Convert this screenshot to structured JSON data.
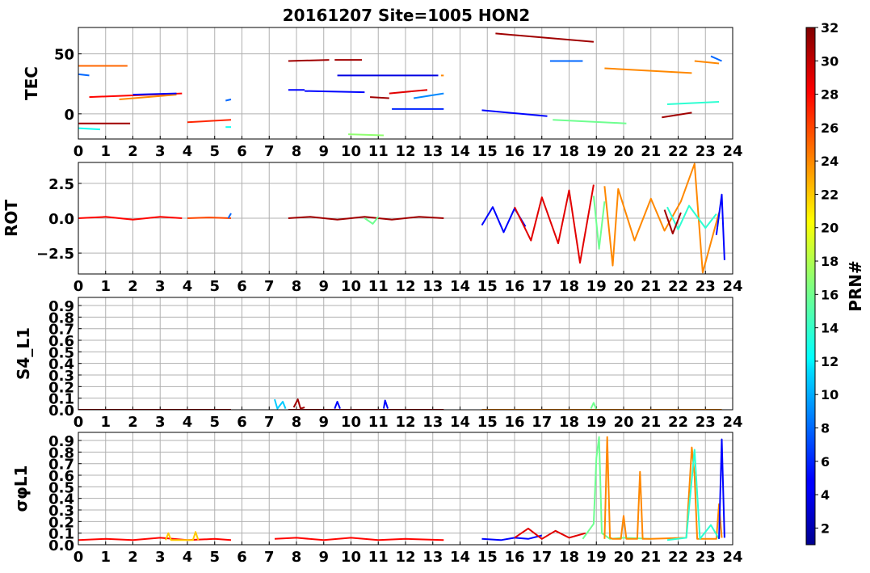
{
  "chart_data": {
    "type": "line",
    "title": "20161207 Site=1005 HON2",
    "x_ticks": [
      "0",
      "1",
      "2",
      "3",
      "4",
      "5",
      "6",
      "7",
      "8",
      "9",
      "10",
      "11",
      "12",
      "13",
      "14",
      "15",
      "16",
      "17",
      "18",
      "19",
      "20",
      "21",
      "22",
      "23",
      "24"
    ],
    "xlim": [
      0,
      24
    ],
    "grid": true,
    "panels": [
      {
        "ylabel": "TEC",
        "ylim": [
          -21,
          72
        ],
        "y_ticks": [
          {
            "v": 50,
            "label": "50"
          },
          {
            "v": 0,
            "label": "0"
          }
        ],
        "series": [
          {
            "prn": 25,
            "x": [
              0.0,
              1.8
            ],
            "y": [
              40,
              40
            ]
          },
          {
            "prn": 8,
            "x": [
              0.0,
              0.4
            ],
            "y": [
              33,
              32
            ]
          },
          {
            "prn": 28,
            "x": [
              0.4,
              3.8
            ],
            "y": [
              14,
              17
            ]
          },
          {
            "prn": 24,
            "x": [
              1.5,
              3.6
            ],
            "y": [
              12,
              16
            ]
          },
          {
            "prn": 5,
            "x": [
              2.0,
              3.6
            ],
            "y": [
              16,
              17
            ]
          },
          {
            "prn": 31,
            "x": [
              0.0,
              1.9
            ],
            "y": [
              -8,
              -8
            ]
          },
          {
            "prn": 13,
            "x": [
              0.0,
              0.8
            ],
            "y": [
              -12,
              -13
            ]
          },
          {
            "prn": 27,
            "x": [
              4.0,
              5.6
            ],
            "y": [
              -7,
              -5
            ]
          },
          {
            "prn": 8,
            "x": [
              5.4,
              5.6
            ],
            "y": [
              11,
              12
            ]
          },
          {
            "prn": 13,
            "x": [
              5.4,
              5.6
            ],
            "y": [
              -11,
              -11
            ]
          },
          {
            "prn": 31,
            "x": [
              7.7,
              9.2
            ],
            "y": [
              44,
              45
            ]
          },
          {
            "prn": 31,
            "x": [
              9.4,
              10.4
            ],
            "y": [
              45,
              45
            ]
          },
          {
            "prn": 5,
            "x": [
              7.7,
              8.3
            ],
            "y": [
              20,
              20
            ]
          },
          {
            "prn": 5,
            "x": [
              8.3,
              10.5
            ],
            "y": [
              19,
              18
            ]
          },
          {
            "prn": 4,
            "x": [
              9.5,
              13.2
            ],
            "y": [
              32,
              32
            ]
          },
          {
            "prn": 31,
            "x": [
              10.7,
              11.4
            ],
            "y": [
              14,
              13
            ]
          },
          {
            "prn": 29,
            "x": [
              11.4,
              12.8
            ],
            "y": [
              17,
              20
            ]
          },
          {
            "prn": 9,
            "x": [
              12.3,
              13.4
            ],
            "y": [
              13,
              17
            ]
          },
          {
            "prn": 6,
            "x": [
              11.5,
              13.4
            ],
            "y": [
              4,
              4
            ]
          },
          {
            "prn": 17,
            "x": [
              9.9,
              11.2
            ],
            "y": [
              -17,
              -18
            ]
          },
          {
            "prn": 24,
            "x": [
              13.3,
              13.4
            ],
            "y": [
              32,
              32
            ]
          },
          {
            "prn": 31,
            "x": [
              15.3,
              18.9
            ],
            "y": [
              67,
              60
            ]
          },
          {
            "prn": 8,
            "x": [
              17.3,
              18.5
            ],
            "y": [
              44,
              44
            ]
          },
          {
            "prn": 5,
            "x": [
              14.8,
              17.2
            ],
            "y": [
              3,
              -2
            ]
          },
          {
            "prn": 16,
            "x": [
              17.4,
              20.1
            ],
            "y": [
              -5,
              -8
            ]
          },
          {
            "prn": 24,
            "x": [
              19.3,
              22.5
            ],
            "y": [
              38,
              34
            ]
          },
          {
            "prn": 24,
            "x": [
              22.6,
              23.5
            ],
            "y": [
              44,
              42
            ]
          },
          {
            "prn": 8,
            "x": [
              23.2,
              23.6
            ],
            "y": [
              48,
              44
            ]
          },
          {
            "prn": 14,
            "x": [
              21.6,
              23.5
            ],
            "y": [
              8,
              10
            ]
          },
          {
            "prn": 31,
            "x": [
              21.4,
              22.5
            ],
            "y": [
              -3,
              1
            ]
          }
        ]
      },
      {
        "ylabel": "ROT",
        "ylim": [
          -4.0,
          4.0
        ],
        "y_ticks": [
          {
            "v": 2.5,
            "label": "2.5"
          },
          {
            "v": 0,
            "label": "0.0"
          },
          {
            "v": -2.5,
            "label": "−2.5"
          }
        ],
        "series": [
          {
            "prn": 28,
            "x": [
              0.0,
              1.0,
              2.0,
              3.0,
              3.8
            ],
            "y": [
              0.0,
              0.1,
              -0.1,
              0.1,
              0.0
            ]
          },
          {
            "prn": 26,
            "x": [
              4.0,
              4.8,
              5.6
            ],
            "y": [
              0.0,
              0.05,
              0.0
            ]
          },
          {
            "prn": 8,
            "x": [
              5.5,
              5.6
            ],
            "y": [
              0.0,
              0.35
            ]
          },
          {
            "prn": 31,
            "x": [
              7.7,
              8.5,
              9.5,
              10.5,
              11.5,
              12.5,
              13.4
            ],
            "y": [
              0.0,
              0.1,
              -0.1,
              0.1,
              -0.1,
              0.1,
              0.0
            ]
          },
          {
            "prn": 16,
            "x": [
              10.5,
              10.8,
              11.0
            ],
            "y": [
              0.0,
              -0.4,
              0.1
            ]
          },
          {
            "prn": 5,
            "x": [
              14.8,
              15.2,
              15.6,
              16.0,
              16.4
            ],
            "y": [
              -0.5,
              0.8,
              -1.0,
              0.7,
              -0.6
            ]
          },
          {
            "prn": 29,
            "x": [
              16.0,
              16.6,
              17.0,
              17.6,
              18.0,
              18.4,
              18.9
            ],
            "y": [
              0.8,
              -1.6,
              1.5,
              -1.8,
              2.0,
              -3.2,
              2.4
            ]
          },
          {
            "prn": 16,
            "x": [
              18.9,
              19.1,
              19.3
            ],
            "y": [
              1.6,
              -2.2,
              1.2
            ]
          },
          {
            "prn": 24,
            "x": [
              19.3,
              19.6,
              19.8,
              20.4,
              21.0,
              21.5,
              22.1,
              22.6,
              22.9,
              23.5
            ],
            "y": [
              2.3,
              -3.4,
              2.1,
              -1.6,
              1.4,
              -0.9,
              1.2,
              3.9,
              -3.9,
              0.4
            ]
          },
          {
            "prn": 14,
            "x": [
              21.6,
              22.0,
              22.4,
              23.0,
              23.4
            ],
            "y": [
              0.8,
              -0.8,
              0.9,
              -0.7,
              0.3
            ]
          },
          {
            "prn": 31,
            "x": [
              21.5,
              21.8,
              22.1
            ],
            "y": [
              0.6,
              -1.1,
              0.4
            ]
          },
          {
            "prn": 5,
            "x": [
              23.4,
              23.6,
              23.7
            ],
            "y": [
              -1.2,
              1.7,
              -3.0
            ]
          }
        ]
      },
      {
        "ylabel": "S4_L1",
        "ylim": [
          0.0,
          0.97
        ],
        "y_ticks": [
          {
            "v": 0.0,
            "label": "0.0"
          },
          {
            "v": 0.1,
            "label": "0.1"
          },
          {
            "v": 0.2,
            "label": "0.2"
          },
          {
            "v": 0.3,
            "label": "0.3"
          },
          {
            "v": 0.4,
            "label": "0.4"
          },
          {
            "v": 0.5,
            "label": "0.5"
          },
          {
            "v": 0.6,
            "label": "0.6"
          },
          {
            "v": 0.7,
            "label": "0.7"
          },
          {
            "v": 0.8,
            "label": "0.8"
          },
          {
            "v": 0.9,
            "label": "0.9"
          }
        ],
        "series": [
          {
            "prn": 31,
            "x": [
              0.0,
              5.6
            ],
            "y": [
              0.0,
              0.0
            ]
          },
          {
            "prn": 11,
            "x": [
              7.2,
              7.3,
              7.5,
              7.6
            ],
            "y": [
              0.09,
              0.01,
              0.07,
              0.01
            ]
          },
          {
            "prn": 31,
            "x": [
              7.9,
              8.05,
              8.15,
              8.3
            ],
            "y": [
              0.02,
              0.09,
              0.01,
              0.02
            ]
          },
          {
            "prn": 5,
            "x": [
              9.4,
              9.5,
              9.6
            ],
            "y": [
              0.01,
              0.07,
              0.01
            ]
          },
          {
            "prn": 5,
            "x": [
              11.2,
              11.25,
              11.35
            ],
            "y": [
              0.01,
              0.08,
              0.01
            ]
          },
          {
            "prn": 31,
            "x": [
              7.7,
              13.4
            ],
            "y": [
              0.0,
              0.0
            ]
          },
          {
            "prn": 16,
            "x": [
              18.8,
              18.9,
              19.0
            ],
            "y": [
              0.01,
              0.06,
              0.0
            ]
          },
          {
            "prn": 24,
            "x": [
              14.8,
              23.6
            ],
            "y": [
              0.0,
              0.0
            ]
          }
        ]
      },
      {
        "ylabel": "σφL1",
        "ylim": [
          0.0,
          0.97
        ],
        "y_ticks": [
          {
            "v": 0.0,
            "label": "0.0"
          },
          {
            "v": 0.1,
            "label": "0.1"
          },
          {
            "v": 0.2,
            "label": "0.2"
          },
          {
            "v": 0.3,
            "label": "0.3"
          },
          {
            "v": 0.4,
            "label": "0.4"
          },
          {
            "v": 0.5,
            "label": "0.5"
          },
          {
            "v": 0.6,
            "label": "0.6"
          },
          {
            "v": 0.7,
            "label": "0.7"
          },
          {
            "v": 0.8,
            "label": "0.8"
          },
          {
            "v": 0.9,
            "label": "0.9"
          }
        ],
        "series": [
          {
            "prn": 28,
            "x": [
              0.0,
              1.0,
              2.0,
              3.0,
              4.0,
              5.0,
              5.6
            ],
            "y": [
              0.04,
              0.05,
              0.04,
              0.06,
              0.04,
              0.05,
              0.04
            ]
          },
          {
            "prn": 22,
            "x": [
              3.2,
              3.3,
              3.4,
              4.2,
              4.3,
              4.4
            ],
            "y": [
              0.04,
              0.1,
              0.04,
              0.04,
              0.11,
              0.04
            ]
          },
          {
            "prn": 28,
            "x": [
              7.2,
              8.0,
              9.0,
              10.0,
              11.0,
              12.0,
              13.4
            ],
            "y": [
              0.05,
              0.06,
              0.04,
              0.06,
              0.04,
              0.05,
              0.04
            ]
          },
          {
            "prn": 5,
            "x": [
              14.8,
              15.5,
              16.0,
              16.5,
              17.0
            ],
            "y": [
              0.05,
              0.04,
              0.06,
              0.05,
              0.08
            ]
          },
          {
            "prn": 29,
            "x": [
              16.0,
              16.5,
              17.0,
              17.5,
              18.0,
              18.6
            ],
            "y": [
              0.06,
              0.14,
              0.05,
              0.12,
              0.06,
              0.1
            ]
          },
          {
            "prn": 16,
            "x": [
              18.5,
              18.9,
              19.0,
              19.1,
              19.2,
              19.5,
              20.0,
              21.0
            ],
            "y": [
              0.05,
              0.18,
              0.75,
              0.93,
              0.1,
              0.05,
              0.06,
              0.05
            ]
          },
          {
            "prn": 24,
            "x": [
              19.3,
              19.4,
              19.5,
              19.6,
              19.9,
              20.0,
              20.1,
              20.5,
              20.6,
              20.7,
              21.0,
              22.3,
              22.5,
              22.6,
              22.7,
              22.9,
              23.4,
              23.5,
              23.6
            ],
            "y": [
              0.05,
              0.93,
              0.06,
              0.05,
              0.05,
              0.25,
              0.05,
              0.05,
              0.63,
              0.05,
              0.05,
              0.06,
              0.84,
              0.6,
              0.05,
              0.05,
              0.05,
              0.35,
              0.06
            ]
          },
          {
            "prn": 14,
            "x": [
              21.6,
              22.3,
              22.6,
              22.8,
              23.2,
              23.5
            ],
            "y": [
              0.04,
              0.06,
              0.82,
              0.05,
              0.17,
              0.05
            ]
          },
          {
            "prn": 5,
            "x": [
              23.5,
              23.6,
              23.7
            ],
            "y": [
              0.05,
              0.91,
              0.06
            ]
          }
        ]
      }
    ],
    "colorbar": {
      "label": "PRN#",
      "range": [
        1,
        32
      ],
      "ticks": [
        "2",
        "4",
        "6",
        "8",
        "10",
        "12",
        "14",
        "16",
        "18",
        "20",
        "22",
        "24",
        "26",
        "28",
        "30",
        "32"
      ],
      "colormap": "jet"
    }
  }
}
